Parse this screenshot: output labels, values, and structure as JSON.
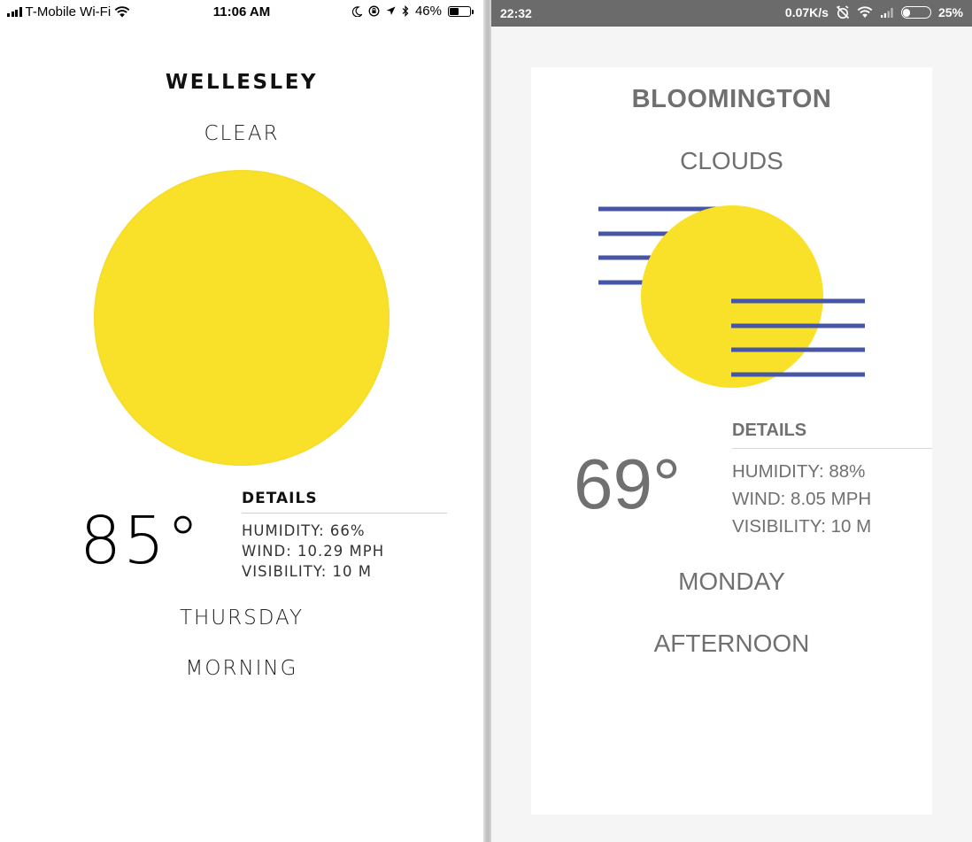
{
  "left": {
    "status_bar": {
      "carrier": "T-Mobile Wi-Fi",
      "time": "11:06 AM",
      "battery": "46%",
      "battery_level": 0.46,
      "icons": [
        "signal-bars-icon",
        "wifi-icon",
        "moon-icon",
        "rotation-lock-icon",
        "location-arrow-icon",
        "bluetooth-icon",
        "battery-icon"
      ]
    },
    "weather": {
      "city": "WELLESLEY",
      "condition": "CLEAR",
      "temperature": "85°",
      "details_heading": "DETAILS",
      "humidity": "HUMIDITY: 66%",
      "wind": "WIND: 10.29 MPH",
      "visibility": "VISIBILITY: 10 M",
      "day": "THURSDAY",
      "time_of_day": "MORNING",
      "icon": "sun-icon"
    },
    "colors": {
      "sun": "#f9e12a",
      "text": "#111111"
    }
  },
  "right": {
    "status_bar": {
      "time": "22:32",
      "network_speed": "0.07K/s",
      "battery": "25%",
      "battery_level": 0.25,
      "icons": [
        "alarm-off-icon",
        "wifi-icon",
        "signal-bars-icon",
        "battery-icon"
      ]
    },
    "weather": {
      "city": "BLOOMINGTON",
      "condition": "CLOUDS",
      "temperature": "69°",
      "details_heading": "DETAILS",
      "humidity": "HUMIDITY: 88%",
      "wind": "WIND: 8.05 MPH",
      "visibility": "VISIBILITY: 10 M",
      "day": "MONDAY",
      "time_of_day": "AFTERNOON",
      "icon": "sun-behind-clouds-icon"
    },
    "colors": {
      "sun": "#f9e12a",
      "cloud_lines": "#4655a5",
      "text": "#707070",
      "status_bar": "#6b6b6b"
    }
  }
}
